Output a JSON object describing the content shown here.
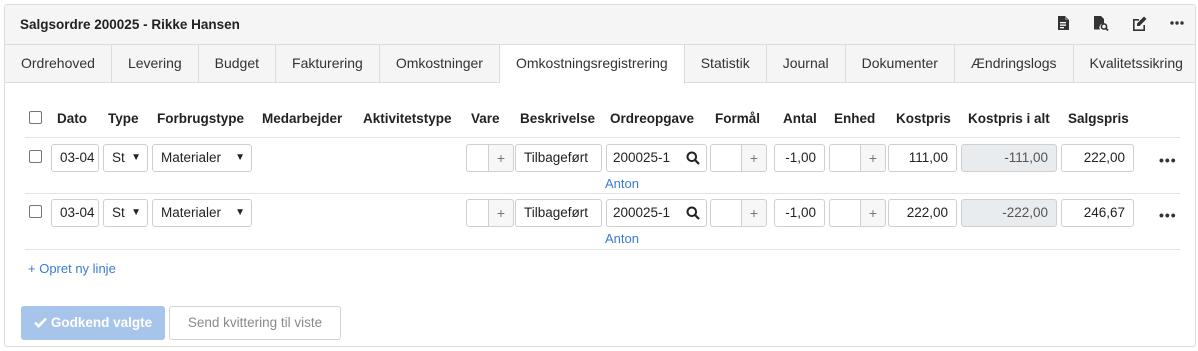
{
  "title": "Salgsordre 200025 - Rikke Hansen",
  "header_icons": [
    "document-icon",
    "document-search-icon",
    "edit-icon",
    "more-icon"
  ],
  "tabs": [
    {
      "label": "Ordrehoved"
    },
    {
      "label": "Levering"
    },
    {
      "label": "Budget"
    },
    {
      "label": "Fakturering"
    },
    {
      "label": "Omkostninger"
    },
    {
      "label": "Omkostningsregistrering",
      "active": true
    },
    {
      "label": "Statistik"
    },
    {
      "label": "Journal"
    },
    {
      "label": "Dokumenter"
    },
    {
      "label": "Ændringslogs"
    },
    {
      "label": "Kvalitetssikring"
    }
  ],
  "columns": {
    "dato": "Dato",
    "type": "Type",
    "forbrugstype": "Forbrugstype",
    "medarbejder": "Medarbejder",
    "aktivitetstype": "Aktivitetstype",
    "vare": "Vare",
    "beskrivelse": "Beskrivelse",
    "ordreopgave": "Ordreopgave",
    "formaal": "Formål",
    "antal": "Antal",
    "enhed": "Enhed",
    "kostpris": "Kostpris",
    "kostpris_i_alt": "Kostpris i alt",
    "salgspris": "Salgspris"
  },
  "rows": [
    {
      "dato": "03-04",
      "type": "St",
      "forbrugstype": "Materialer",
      "beskrivelse": "Tilbageført",
      "ordreopgave": "200025-1",
      "ordreopgave_sub": "Anton",
      "antal": "-1,00",
      "kostpris": "111,00",
      "kostpris_i_alt": "-111,00",
      "salgspris": "222,00"
    },
    {
      "dato": "03-04",
      "type": "St",
      "forbrugstype": "Materialer",
      "beskrivelse": "Tilbageført",
      "ordreopgave": "200025-1",
      "ordreopgave_sub": "Anton",
      "antal": "-1,00",
      "kostpris": "222,00",
      "kostpris_i_alt": "-222,00",
      "salgspris": "246,67"
    }
  ],
  "add_line": "+ Opret ny linje",
  "approve_button": "Godkend valgte",
  "send_receipt_button": "Send kvittering til viste",
  "accent": "#3a7bd5",
  "disabled_primary": "#a7c4ea"
}
